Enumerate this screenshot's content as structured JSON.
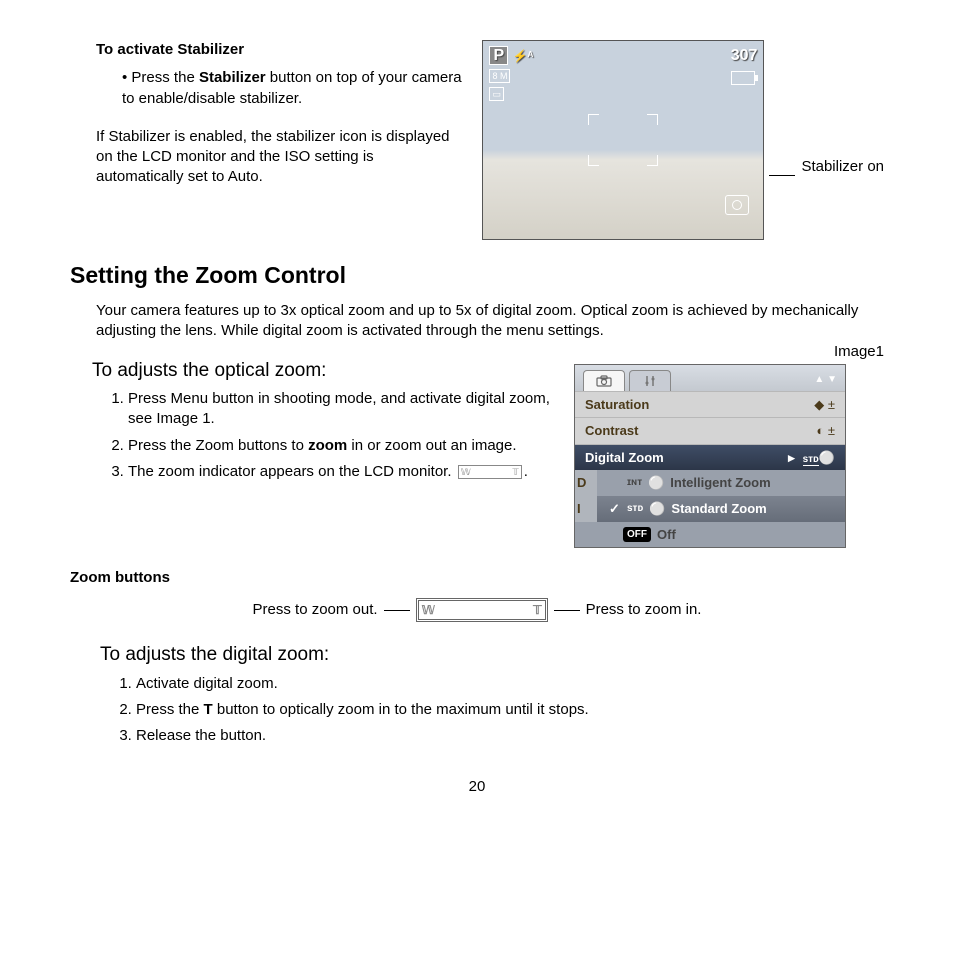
{
  "top": {
    "heading": "To activate Stabilizer",
    "bullet_prefix": "• Press the ",
    "bullet_bold": "Stabilizer",
    "bullet_suffix": " button on top of your camera to enable/disable stabilizer.",
    "para": "If Stabilizer is enabled, the stabilizer icon is displayed on the LCD monitor and the ISO setting is automatically set to Auto.",
    "callout": "Stabilizer on"
  },
  "lcd": {
    "mode": "P",
    "flash": "⚡ᴬ",
    "shots": "307",
    "size": "8 M"
  },
  "main_heading": "Setting the Zoom Control",
  "intro": "Your camera features up to 3x optical zoom and up to 5x of digital zoom. Optical zoom is achieved by mechanically adjusting the lens. While digital zoom is activated through the menu settings.",
  "optical": {
    "heading": "To adjusts the optical zoom:",
    "step1": "Press Menu button in shooting mode, and activate digital zoom, see Image 1.",
    "step2_a": "Press the Zoom buttons to ",
    "step2_b": "zoom",
    "step2_c": " in or zoom out an image.",
    "step3": "The zoom indicator appears on the LCD monitor.",
    "w": "𝕎",
    "t": "𝕋"
  },
  "image1_label": "Image1",
  "menu": {
    "arrows": "▲ ▼",
    "row1": "Saturation",
    "row1_val": "◆ ±",
    "row2": "Contrast",
    "row2_val": "◐ ±",
    "row3": "Digital Zoom",
    "row3_arrow": "▸",
    "row3_icon": "ѕᴛᴅ",
    "row4_prefix": "D",
    "row5_prefix": "I",
    "sub1": "Intelligent Zoom",
    "sub1_icon": "ɪɴᴛ",
    "sub2": "Standard Zoom",
    "sub2_icon": "ѕᴛᴅ",
    "sub3": "Off",
    "off_badge": "OFF"
  },
  "zoom_sub": "Zoom buttons",
  "zoom_out": "Press to zoom out.",
  "zoom_in": "Press to zoom in.",
  "digital": {
    "heading": "To adjusts the digital zoom:",
    "step1": "Activate digital zoom.",
    "step2_a": "Press the ",
    "step2_b": "T",
    "step2_c": " button to optically zoom in to the maximum until it stops.",
    "step3": "Release the button."
  },
  "page": "20"
}
